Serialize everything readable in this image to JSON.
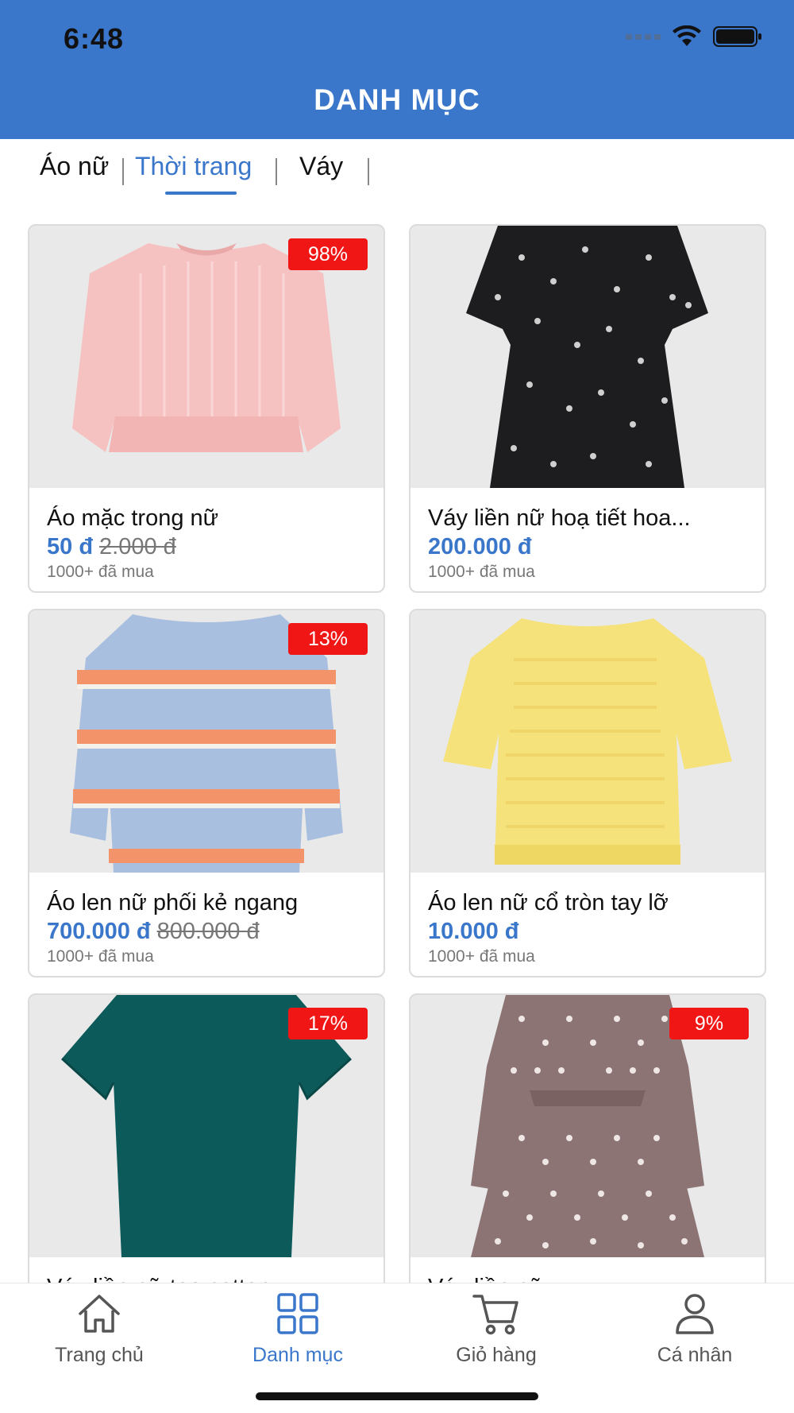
{
  "status_bar": {
    "time": "6:48"
  },
  "header": {
    "title": "DANH MỤC"
  },
  "tabs": [
    {
      "label": "Áo nữ",
      "active": false
    },
    {
      "label": "Thời trang",
      "active": true
    },
    {
      "label": "Váy",
      "active": false
    }
  ],
  "products": [
    {
      "name": "Áo mặc trong nữ",
      "price": "50 đ",
      "old_price": "2.000 đ",
      "sold": "1000+ đã mua",
      "discount": "98%",
      "image": "pink-ruffle-top"
    },
    {
      "name": "Váy liền nữ hoạ tiết hoa...",
      "price": "200.000 đ",
      "old_price": "",
      "sold": "1000+ đã mua",
      "discount": "",
      "image": "black-floral-dress"
    },
    {
      "name": "Áo len nữ phối kẻ ngang",
      "price": "700.000 đ",
      "old_price": "800.000 đ",
      "sold": "1000+ đã mua",
      "discount": "13%",
      "image": "striped-sweater"
    },
    {
      "name": "Áo len nữ cổ tròn tay lỡ",
      "price": "10.000 đ",
      "old_price": "",
      "sold": "1000+ đã mua",
      "discount": "",
      "image": "yellow-knit-top"
    },
    {
      "name": "Váy liền nữ tee cotton u...",
      "price": "",
      "old_price": "",
      "sold": "",
      "discount": "17%",
      "image": "teal-tee-dress"
    },
    {
      "name": "Váy liền nữ...",
      "price": "",
      "old_price": "",
      "sold": "",
      "discount": "9%",
      "image": "polka-dot-dress"
    }
  ],
  "bottom_nav": [
    {
      "label": "Trang chủ",
      "icon": "home-icon",
      "active": false
    },
    {
      "label": "Danh mục",
      "icon": "grid-icon",
      "active": true
    },
    {
      "label": "Giỏ hàng",
      "icon": "cart-icon",
      "active": false
    },
    {
      "label": "Cá nhân",
      "icon": "user-icon",
      "active": false
    }
  ],
  "colors": {
    "accent": "#3a77cb",
    "badge": "#f01616"
  }
}
